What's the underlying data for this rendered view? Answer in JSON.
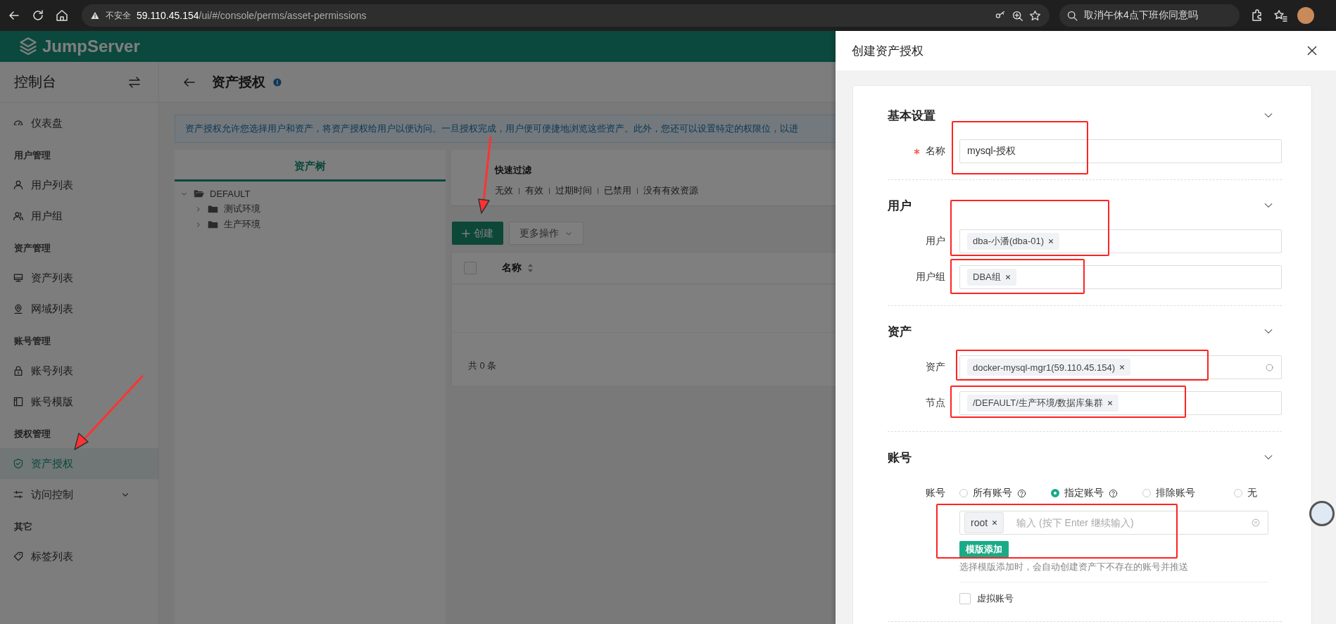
{
  "browser": {
    "security_label": "不安全",
    "url_host": "59.110.45.154",
    "url_path": "/ui/#/console/perms/asset-permissions",
    "search_text": "取消午休4点下班你同意吗"
  },
  "app": {
    "brand": "JumpServer"
  },
  "sidebar": {
    "title": "控制台",
    "items": [
      {
        "kind": "item",
        "label": "仪表盘",
        "selected": false
      },
      {
        "kind": "group",
        "label": "用户管理"
      },
      {
        "kind": "item",
        "label": "用户列表",
        "selected": false
      },
      {
        "kind": "item",
        "label": "用户组",
        "selected": false
      },
      {
        "kind": "group",
        "label": "资产管理"
      },
      {
        "kind": "item",
        "label": "资产列表",
        "selected": false
      },
      {
        "kind": "item",
        "label": "网域列表",
        "selected": false
      },
      {
        "kind": "group",
        "label": "账号管理"
      },
      {
        "kind": "item",
        "label": "账号列表",
        "selected": false
      },
      {
        "kind": "item",
        "label": "账号模版",
        "selected": false
      },
      {
        "kind": "group",
        "label": "授权管理"
      },
      {
        "kind": "item",
        "label": "资产授权",
        "selected": true
      },
      {
        "kind": "submenu",
        "label": "访问控制",
        "selected": false
      },
      {
        "kind": "group",
        "label": "其它"
      },
      {
        "kind": "item",
        "label": "标签列表",
        "selected": false
      }
    ]
  },
  "page": {
    "title": "资产授权",
    "notice": "资产授权允许您选择用户和资产，将资产授权给用户以便访问。一旦授权完成，用户便可便捷地浏览这些资产。此外，您还可以设置特定的权限位，以进"
  },
  "tree": {
    "tab": "资产树",
    "nodes": [
      {
        "label": "DEFAULT",
        "expanded": true,
        "children": [
          {
            "label": "测试环境",
            "expanded": false
          },
          {
            "label": "生产环境",
            "expanded": false
          }
        ]
      }
    ]
  },
  "filter": {
    "title": "快速过滤",
    "options": [
      "无效",
      "有效",
      "过期时间",
      "已禁用",
      "没有有效资源"
    ]
  },
  "actions": {
    "create": "创建",
    "more": "更多操作"
  },
  "table": {
    "select_all": {
      "checked": false
    },
    "columns": [
      {
        "label": "名称"
      }
    ],
    "total": "共 0 条"
  },
  "drawer": {
    "title": "创建资产授权",
    "sections": [
      {
        "title": "基本设置",
        "fields": [
          {
            "kind": "text",
            "label": "名称",
            "required": true,
            "value": "mysql-授权"
          }
        ]
      },
      {
        "title": "用户",
        "fields": [
          {
            "kind": "tags",
            "label": "用户",
            "tags": [
              "dba-小潘(dba-01)"
            ]
          },
          {
            "kind": "tags",
            "label": "用户组",
            "tags": [
              "DBA组"
            ]
          }
        ]
      },
      {
        "title": "资产",
        "fields": [
          {
            "kind": "tags",
            "label": "资产",
            "search": true,
            "tags": [
              "docker-mysql-mgr1(59.110.45.154)"
            ]
          },
          {
            "kind": "tags",
            "label": "节点",
            "tags": [
              "/DEFAULT/生产环境/数据库集群"
            ]
          }
        ]
      },
      {
        "title": "账号",
        "fields": [
          {
            "kind": "radio",
            "label": "账号",
            "options": [
              {
                "label": "所有账号",
                "help": true,
                "selected": false
              },
              {
                "label": "指定账号",
                "help": true,
                "selected": true
              },
              {
                "label": "排除账号",
                "help": false,
                "selected": false
              },
              {
                "label": "无",
                "help": false,
                "selected": false
              }
            ]
          }
        ],
        "account_input": {
          "tags": [
            "root"
          ],
          "placeholder": "输入 (按下 Enter 继续输入)"
        },
        "template_button": "模版添加",
        "hint": "选择模版添加时，会自动创建资产下不存在的账号并推送",
        "virtual": {
          "label": "虚拟账号",
          "checked": false
        }
      }
    ]
  }
}
